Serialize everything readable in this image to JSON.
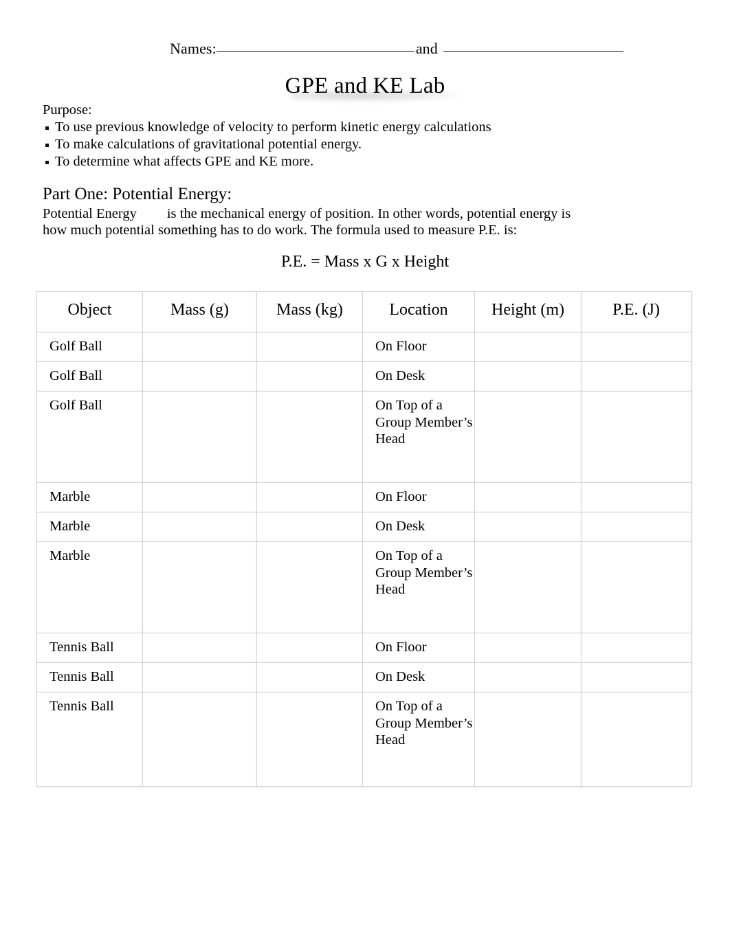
{
  "header": {
    "names_label": "Names:",
    "and_label": "and"
  },
  "title": "GPE and KE Lab",
  "purpose": {
    "heading": "Purpose:",
    "items": [
      "To use previous knowledge of velocity to perform kinetic energy calculations",
      "To make calculations of gravitational potential energy.",
      "To determine what affects GPE and KE more."
    ]
  },
  "part_one": {
    "heading": "Part One: Potential Energy:",
    "term": "Potential Energy",
    "definition": "is the mechanical energy of position. In other words, potential energy is how much potential something has to do work. The formula used to measure P.E. is:",
    "formula": "P.E. = Mass x G x Height"
  },
  "table": {
    "columns": [
      "Object",
      "Mass (g)",
      "Mass (kg)",
      "Location",
      "Height (m)",
      "P.E. (J)"
    ],
    "rows": [
      {
        "object": "Golf Ball",
        "mass_g": "",
        "mass_kg": "",
        "location": "On Floor",
        "height_m": "",
        "pe_j": "",
        "size": "short"
      },
      {
        "object": "Golf Ball",
        "mass_g": "",
        "mass_kg": "",
        "location": "On Desk",
        "height_m": "",
        "pe_j": "",
        "size": "short"
      },
      {
        "object": "Golf Ball",
        "mass_g": "",
        "mass_kg": "",
        "location": "On Top of a Group Member’s Head",
        "height_m": "",
        "pe_j": "",
        "size": "tall"
      },
      {
        "object": "Marble",
        "mass_g": "",
        "mass_kg": "",
        "location": "On Floor",
        "height_m": "",
        "pe_j": "",
        "size": "short"
      },
      {
        "object": "Marble",
        "mass_g": "",
        "mass_kg": "",
        "location": "On Desk",
        "height_m": "",
        "pe_j": "",
        "size": "short"
      },
      {
        "object": "Marble",
        "mass_g": "",
        "mass_kg": "",
        "location": "On Top of a Group Member’s Head",
        "height_m": "",
        "pe_j": "",
        "size": "tall"
      },
      {
        "object": "Tennis Ball",
        "mass_g": "",
        "mass_kg": "",
        "location": "On Floor",
        "height_m": "",
        "pe_j": "",
        "size": "short"
      },
      {
        "object": "Tennis Ball",
        "mass_g": "",
        "mass_kg": "",
        "location": "On Desk",
        "height_m": "",
        "pe_j": "",
        "size": "short"
      },
      {
        "object": "Tennis Ball",
        "mass_g": "",
        "mass_kg": "",
        "location": "On Top of a Group Member’s Head",
        "height_m": "",
        "pe_j": "",
        "size": "last"
      }
    ]
  },
  "colors": {
    "text": "#000000",
    "page_background": "#ffffff",
    "table_border": "#d3d3d3"
  }
}
